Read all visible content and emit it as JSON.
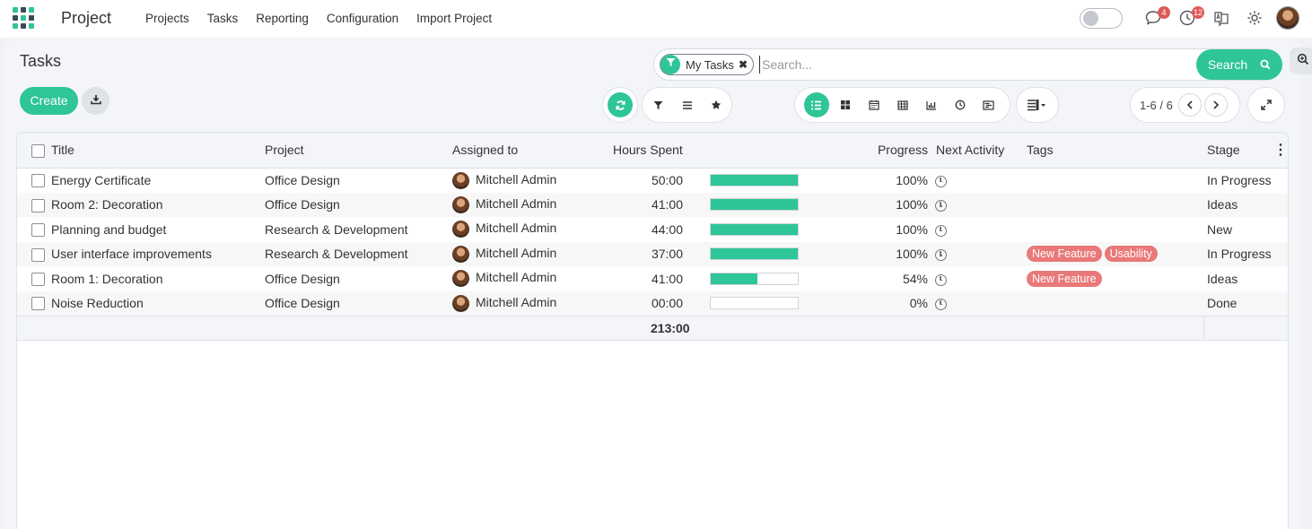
{
  "navbar": {
    "app_title": "Project",
    "menu": [
      "Projects",
      "Tasks",
      "Reporting",
      "Configuration",
      "Import Project"
    ],
    "messages_badge": "4",
    "activities_badge": "12"
  },
  "page": {
    "title": "Tasks"
  },
  "search": {
    "facet_label": "My Tasks",
    "placeholder": "Search...",
    "button_label": "Search"
  },
  "actions": {
    "create_label": "Create"
  },
  "pager": {
    "text": "1-6 / 6"
  },
  "table": {
    "columns": [
      "Title",
      "Project",
      "Assigned to",
      "Hours Spent",
      "Progress",
      "Next Activity",
      "Tags",
      "Stage"
    ],
    "rows": [
      {
        "title": "Energy Certificate",
        "project": "Office Design",
        "assignee": "Mitchell Admin",
        "hours": "50:00",
        "progress": 100,
        "progress_label": "100%",
        "tags": [],
        "stage": "In Progress"
      },
      {
        "title": "Room 2: Decoration",
        "project": "Office Design",
        "assignee": "Mitchell Admin",
        "hours": "41:00",
        "progress": 100,
        "progress_label": "100%",
        "tags": [],
        "stage": "Ideas"
      },
      {
        "title": "Planning and budget",
        "project": "Research & Development",
        "assignee": "Mitchell Admin",
        "hours": "44:00",
        "progress": 100,
        "progress_label": "100%",
        "tags": [],
        "stage": "New"
      },
      {
        "title": "User interface improvements",
        "project": "Research & Development",
        "assignee": "Mitchell Admin",
        "hours": "37:00",
        "progress": 100,
        "progress_label": "100%",
        "tags": [
          "New Feature",
          "Usability"
        ],
        "stage": "In Progress"
      },
      {
        "title": "Room 1: Decoration",
        "project": "Office Design",
        "assignee": "Mitchell Admin",
        "hours": "41:00",
        "progress": 54,
        "progress_label": "54%",
        "tags": [
          "New Feature"
        ],
        "stage": "Ideas"
      },
      {
        "title": "Noise Reduction",
        "project": "Office Design",
        "assignee": "Mitchell Admin",
        "hours": "00:00",
        "progress": 0,
        "progress_label": "0%",
        "tags": [],
        "stage": "Done"
      }
    ],
    "total_hours": "213:00"
  },
  "colors": {
    "accent": "#2ec598",
    "tag": "#e97979",
    "badge": "#e05a5a"
  },
  "icons": [
    "apps-grid-icon",
    "messages-icon",
    "activity-clock-icon",
    "language-icon",
    "settings-gear-icon",
    "filter-icon",
    "refresh-icon",
    "list-icon",
    "kanban-icon",
    "calendar-icon",
    "pivot-icon",
    "graph-icon",
    "activity-icon",
    "gantt-icon",
    "zoom-icon",
    "download-icon",
    "expand-icon"
  ]
}
